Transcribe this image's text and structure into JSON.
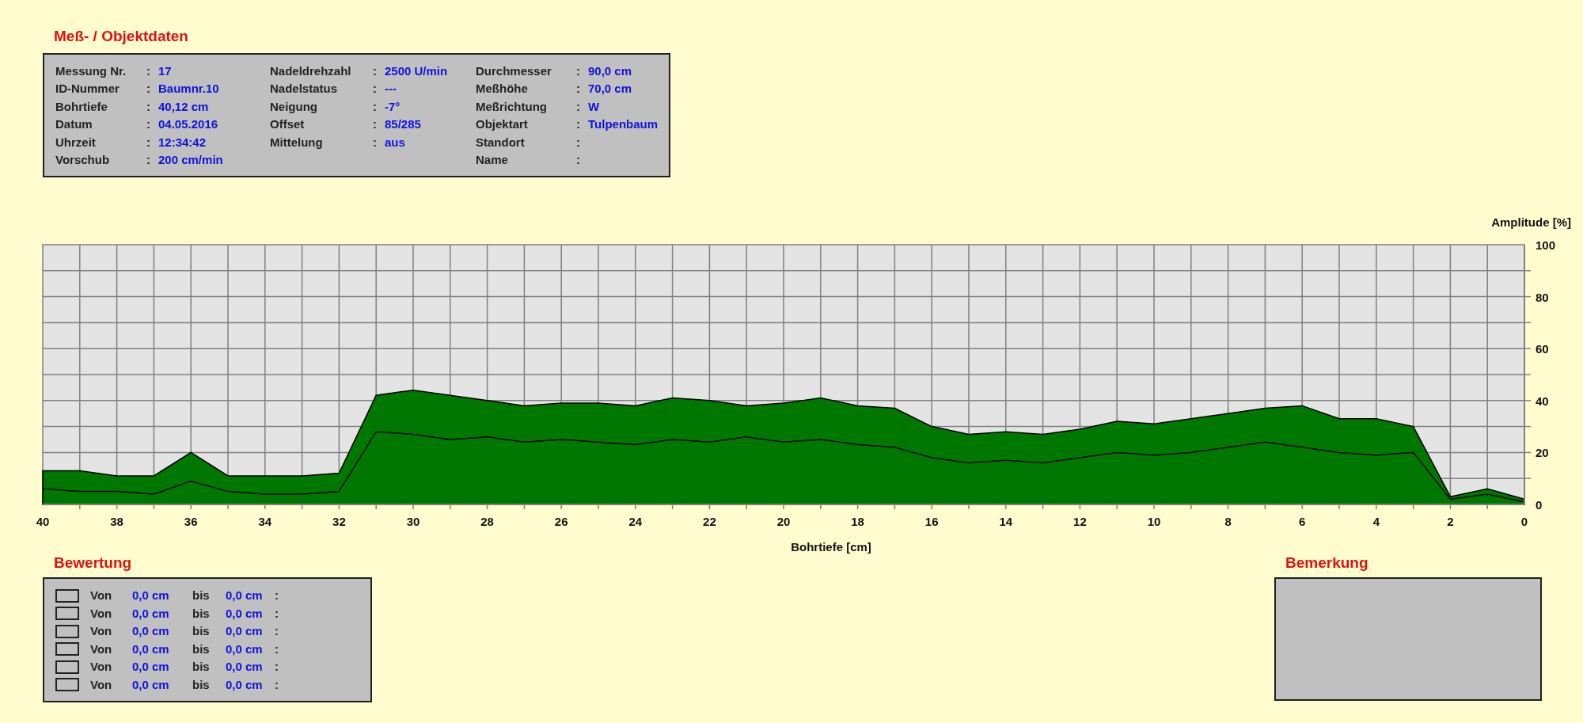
{
  "object_data": {
    "title": "Meß- / Objektdaten",
    "columns": [
      [
        {
          "label": "Messung Nr.",
          "colon": ":",
          "value": "17"
        },
        {
          "label": "ID-Nummer",
          "colon": ":",
          "value": "Baumnr.10"
        },
        {
          "label": "Bohrtiefe",
          "colon": ":",
          "value": "40,12 cm"
        },
        {
          "label": "Datum",
          "colon": ":",
          "value": "04.05.2016"
        },
        {
          "label": "Uhrzeit",
          "colon": ":",
          "value": "12:34:42"
        },
        {
          "label": "Vorschub",
          "colon": ":",
          "value": "200 cm/min"
        }
      ],
      [
        {
          "label": "Nadeldrehzahl",
          "colon": ":",
          "value": "2500 U/min"
        },
        {
          "label": "Nadelstatus",
          "colon": ":",
          "value": "---"
        },
        {
          "label": "Neigung",
          "colon": ":",
          "value": "-7°"
        },
        {
          "label": "Offset",
          "colon": ":",
          "value": "85/285"
        },
        {
          "label": "Mittelung",
          "colon": ":",
          "value": "aus"
        }
      ],
      [
        {
          "label": "Durchmesser",
          "colon": ":",
          "value": "90,0 cm"
        },
        {
          "label": "Meßhöhe",
          "colon": ":",
          "value": "70,0 cm"
        },
        {
          "label": "Meßrichtung",
          "colon": ":",
          "value": "W"
        },
        {
          "label": "Objektart",
          "colon": ":",
          "value": "Tulpenbaum"
        },
        {
          "label": "Standort",
          "colon": ":"
        },
        {
          "label": "Name",
          "colon": ":"
        }
      ]
    ]
  },
  "chart": {
    "chart_data": {
      "type": "area",
      "xlabel": "Bohrtiefe [cm]",
      "ylabel": "Amplitude [%]",
      "x": [
        40,
        39,
        38,
        37,
        36,
        35,
        34,
        33,
        32,
        31,
        30,
        29,
        28,
        27,
        26,
        25,
        24,
        23,
        22,
        21,
        20,
        19,
        18,
        17,
        16,
        15,
        14,
        13,
        12,
        11,
        10,
        9,
        8,
        7,
        6,
        5,
        4,
        3,
        2,
        1,
        0
      ],
      "series": [
        {
          "type": "area",
          "color": "#007800",
          "values": [
            13,
            13,
            11,
            11,
            20,
            11,
            11,
            11,
            12,
            42,
            44,
            42,
            40,
            38,
            39,
            39,
            38,
            41,
            40,
            38,
            39,
            41,
            38,
            37,
            30,
            27,
            28,
            27,
            29,
            32,
            31,
            33,
            35,
            37,
            38,
            33,
            33,
            30,
            3,
            6,
            2
          ]
        },
        {
          "type": "line",
          "color": "#000000",
          "values": [
            6,
            5,
            5,
            4,
            9,
            5,
            4,
            4,
            5,
            28,
            27,
            25,
            26,
            24,
            25,
            24,
            23,
            25,
            24,
            26,
            24,
            25,
            23,
            22,
            18,
            16,
            17,
            16,
            18,
            20,
            19,
            20,
            22,
            24,
            22,
            20,
            19,
            20,
            2,
            4,
            1
          ]
        }
      ],
      "xlim": [
        40,
        0
      ],
      "ylim": [
        0,
        100
      ],
      "xticks": [
        40,
        38,
        36,
        34,
        32,
        30,
        28,
        26,
        24,
        22,
        20,
        18,
        16,
        14,
        12,
        10,
        8,
        6,
        4,
        2,
        0
      ],
      "yticks": [
        0,
        20,
        40,
        60,
        80,
        100
      ],
      "grid": true
    }
  },
  "rating": {
    "title": "Bewertung",
    "rows": [
      {
        "from_label": "Von",
        "from": "0,0 cm",
        "to_label": "bis",
        "to": "0,0 cm",
        "colon": ":"
      },
      {
        "from_label": "Von",
        "from": "0,0 cm",
        "to_label": "bis",
        "to": "0,0 cm",
        "colon": ":"
      },
      {
        "from_label": "Von",
        "from": "0,0 cm",
        "to_label": "bis",
        "to": "0,0 cm",
        "colon": ":"
      },
      {
        "from_label": "Von",
        "from": "0,0 cm",
        "to_label": "bis",
        "to": "0,0 cm",
        "colon": ":"
      },
      {
        "from_label": "Von",
        "from": "0,0 cm",
        "to_label": "bis",
        "to": "0,0 cm",
        "colon": ":"
      },
      {
        "from_label": "Von",
        "from": "0,0 cm",
        "to_label": "bis",
        "to": "0,0 cm",
        "colon": ":"
      }
    ]
  },
  "remark": {
    "title": "Bemerkung"
  }
}
